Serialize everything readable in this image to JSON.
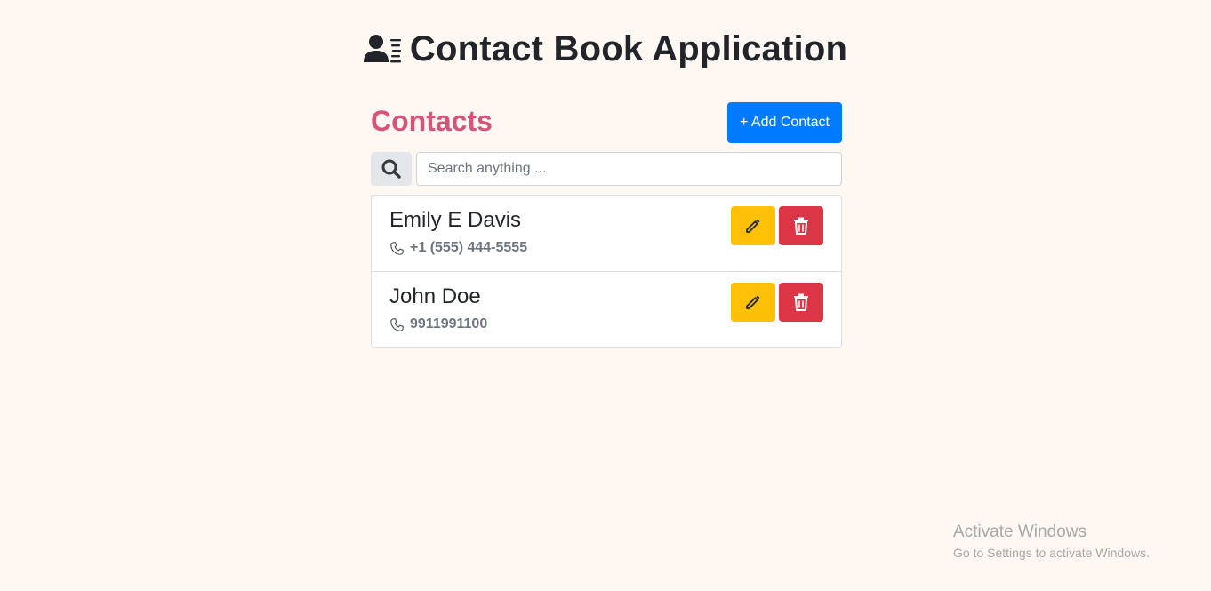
{
  "app": {
    "title": "Contact Book Application",
    "icon": "address-book-icon"
  },
  "contacts_section": {
    "title": "Contacts",
    "add_button_label": "+ Add Contact"
  },
  "search": {
    "placeholder": "Search anything ...",
    "value": "",
    "icon": "search-icon"
  },
  "contacts": [
    {
      "name": "Emily E Davis",
      "phone": "+1 (555) 444-5555"
    },
    {
      "name": "John Doe",
      "phone": "9911991100"
    }
  ],
  "watermark": {
    "title": "Activate Windows",
    "subtitle": "Go to Settings to activate Windows."
  },
  "colors": {
    "background": "#fff8f2",
    "accent_title": "#d6537a",
    "primary_button": "#007bff",
    "edit_button": "#ffc107",
    "delete_button": "#dc3545"
  }
}
